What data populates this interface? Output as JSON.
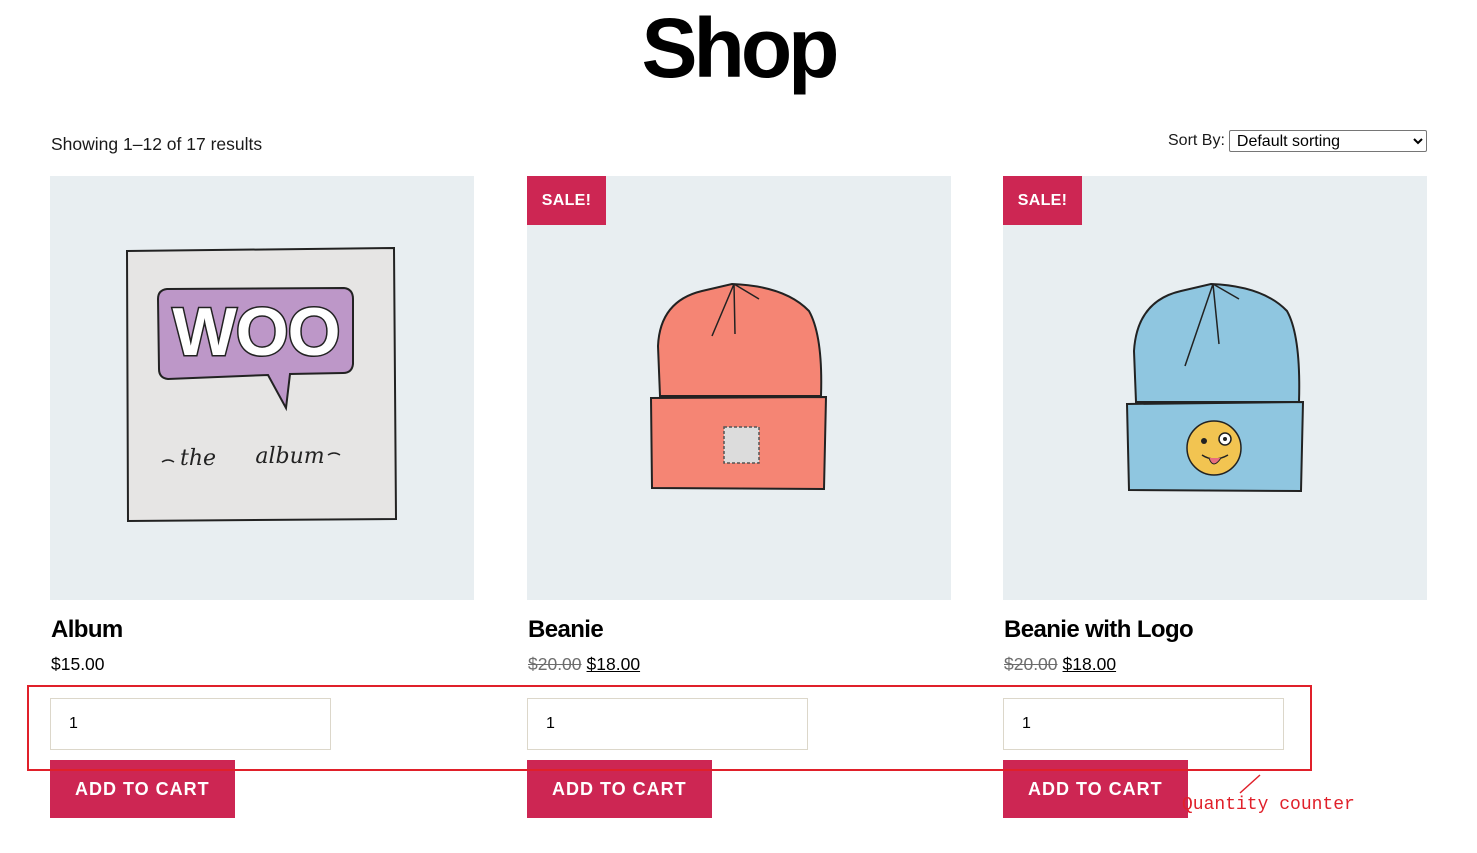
{
  "page": {
    "title": "Shop"
  },
  "toolbar": {
    "result_count": "Showing 1–12 of 17 results",
    "sort_label": "Sort By:",
    "sort_value": "Default sorting"
  },
  "products": [
    {
      "name": "Album",
      "image": "album-woo-illustration",
      "sale_badge": "",
      "regular_price": "$15.00",
      "old_price": "",
      "sale_price": "",
      "quantity": "1",
      "button_label": "ADD TO CART"
    },
    {
      "name": "Beanie",
      "image": "orange-beanie-illustration",
      "sale_badge": "SALE!",
      "regular_price": "",
      "old_price": "$20.00",
      "sale_price": "$18.00",
      "quantity": "1",
      "button_label": "ADD TO CART"
    },
    {
      "name": "Beanie with Logo",
      "image": "blue-beanie-logo-illustration",
      "sale_badge": "SALE!",
      "regular_price": "",
      "old_price": "$20.00",
      "sale_price": "$18.00",
      "quantity": "1",
      "button_label": "ADD TO CART"
    }
  ],
  "album_art": {
    "woo_text": "WOO",
    "caption_left": "the",
    "caption_right": "album"
  },
  "annotation": {
    "label": "Quantity counter",
    "color": "#e0202a"
  },
  "colors": {
    "accent": "#cd2653",
    "image_bg": "#e8eef1"
  }
}
